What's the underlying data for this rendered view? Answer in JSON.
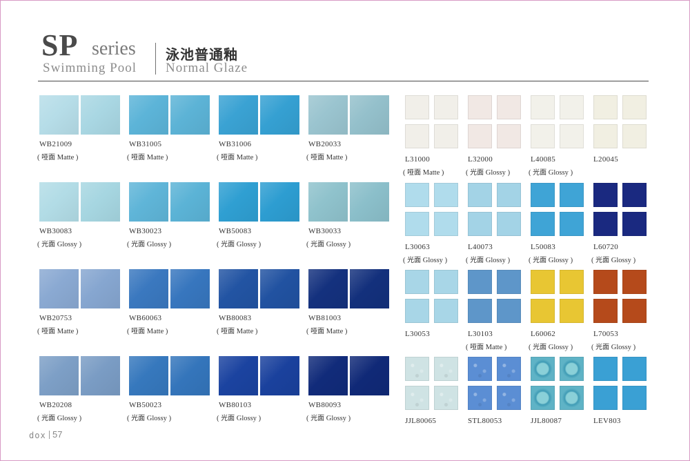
{
  "header": {
    "sp": "SP",
    "series": "series",
    "pool": "Swimming Pool",
    "cn_title": "泳池普通釉",
    "glaze": "Normal Glaze"
  },
  "footer": {
    "logo": "dox",
    "page": "57"
  },
  "big_tiles": [
    {
      "code": "WB21009",
      "finish_cn": "哑面",
      "finish_en": "Matte",
      "colors": [
        "#b6dde8",
        "#a9d7e3"
      ]
    },
    {
      "code": "WB31005",
      "finish_cn": "哑面",
      "finish_en": "Matte",
      "colors": [
        "#5cb4d8",
        "#5cb3d6"
      ]
    },
    {
      "code": "WB31006",
      "finish_cn": "哑面",
      "finish_en": "Matte",
      "colors": [
        "#3aa2d3",
        "#35a0d2"
      ]
    },
    {
      "code": "WB20033",
      "finish_cn": "哑面",
      "finish_en": "Matte",
      "colors": [
        "#9ac4cf",
        "#94c0cb"
      ]
    },
    {
      "code": "WB30083",
      "finish_cn": "光面",
      "finish_en": "Glossy",
      "colors": [
        "#b2dce6",
        "#a6d6e1"
      ]
    },
    {
      "code": "WB30023",
      "finish_cn": "光面",
      "finish_en": "Glossy",
      "colors": [
        "#5fb5d8",
        "#5bb3d6"
      ]
    },
    {
      "code": "WB50083",
      "finish_cn": "光面",
      "finish_en": "Glossy",
      "colors": [
        "#2f9fd2",
        "#2d9dd1"
      ]
    },
    {
      "code": "WB30033",
      "finish_cn": "光面",
      "finish_en": "Glossy",
      "colors": [
        "#8fc2cc",
        "#8bbfca"
      ]
    },
    {
      "code": "WB20753",
      "finish_cn": "哑面",
      "finish_en": "Matte",
      "colors": [
        "#8aa9d2",
        "#86a6d0"
      ]
    },
    {
      "code": "WB60063",
      "finish_cn": "哑面",
      "finish_en": "Matte",
      "colors": [
        "#3a78bf",
        "#3776be"
      ]
    },
    {
      "code": "WB80083",
      "finish_cn": "哑面",
      "finish_en": "Matte",
      "colors": [
        "#2254a3",
        "#2152a1"
      ]
    },
    {
      "code": "WB81003",
      "finish_cn": "哑面",
      "finish_en": "Matte",
      "colors": [
        "#14317e",
        "#13307c"
      ]
    },
    {
      "code": "WB20208",
      "finish_cn": "光面",
      "finish_en": "Glossy",
      "colors": [
        "#7d9fc6",
        "#7a9cc4"
      ]
    },
    {
      "code": "WB50023",
      "finish_cn": "光面",
      "finish_en": "Glossy",
      "colors": [
        "#3678bd",
        "#3475bb"
      ]
    },
    {
      "code": "WB80103",
      "finish_cn": "光面",
      "finish_en": "Glossy",
      "colors": [
        "#1b43a0",
        "#1a419d"
      ]
    },
    {
      "code": "WB80093",
      "finish_cn": "光面",
      "finish_en": "Glossy",
      "colors": [
        "#112b7a",
        "#102977"
      ]
    }
  ],
  "small_tiles": [
    {
      "code": "L31000",
      "finish_cn": "哑面",
      "finish_en": "Matte",
      "color": "#f1efe9"
    },
    {
      "code": "L32000",
      "finish_cn": "光面",
      "finish_en": "Glossy",
      "color": "#f1e8e4"
    },
    {
      "code": "L40085",
      "finish_cn": "光面",
      "finish_en": "Glossy",
      "color": "#f2f1ea"
    },
    {
      "code": "L20045",
      "finish_cn": "",
      "finish_en": "",
      "color": "#f1efe2"
    },
    {
      "code": "L30063",
      "finish_cn": "光面",
      "finish_en": "Glossy",
      "color": "#b0dcec"
    },
    {
      "code": "L40073",
      "finish_cn": "光面",
      "finish_en": "Glossy",
      "color": "#a3d3e6"
    },
    {
      "code": "L50083",
      "finish_cn": "光面",
      "finish_en": "Glossy",
      "color": "#3fa4d6"
    },
    {
      "code": "L60720",
      "finish_cn": "光面",
      "finish_en": "Glossy",
      "color": "#1a2980"
    },
    {
      "code": "L30053",
      "finish_cn": "",
      "finish_en": "",
      "color": "#a8d6e7"
    },
    {
      "code": "L30103",
      "finish_cn": "哑面",
      "finish_en": "Matte",
      "color": "#5e96c9"
    },
    {
      "code": "L60062",
      "finish_cn": "光面",
      "finish_en": "Glossy",
      "color": "#e8c633"
    },
    {
      "code": "L70053",
      "finish_cn": "光面",
      "finish_en": "Glossy",
      "color": "#b54a1b"
    },
    {
      "code": "JJL80065",
      "finish_cn": "",
      "finish_en": "",
      "color": "#cfe3e4",
      "texture": "speckle"
    },
    {
      "code": "STL80053",
      "finish_cn": "",
      "finish_en": "",
      "color": "#5b8ed4",
      "texture": "speckle"
    },
    {
      "code": "JJL80087",
      "finish_cn": "",
      "finish_en": "",
      "color": "#5fb3c6",
      "texture": "ring"
    },
    {
      "code": "LEV803",
      "finish_cn": "",
      "finish_en": "",
      "color": "#3aa0d4"
    }
  ]
}
